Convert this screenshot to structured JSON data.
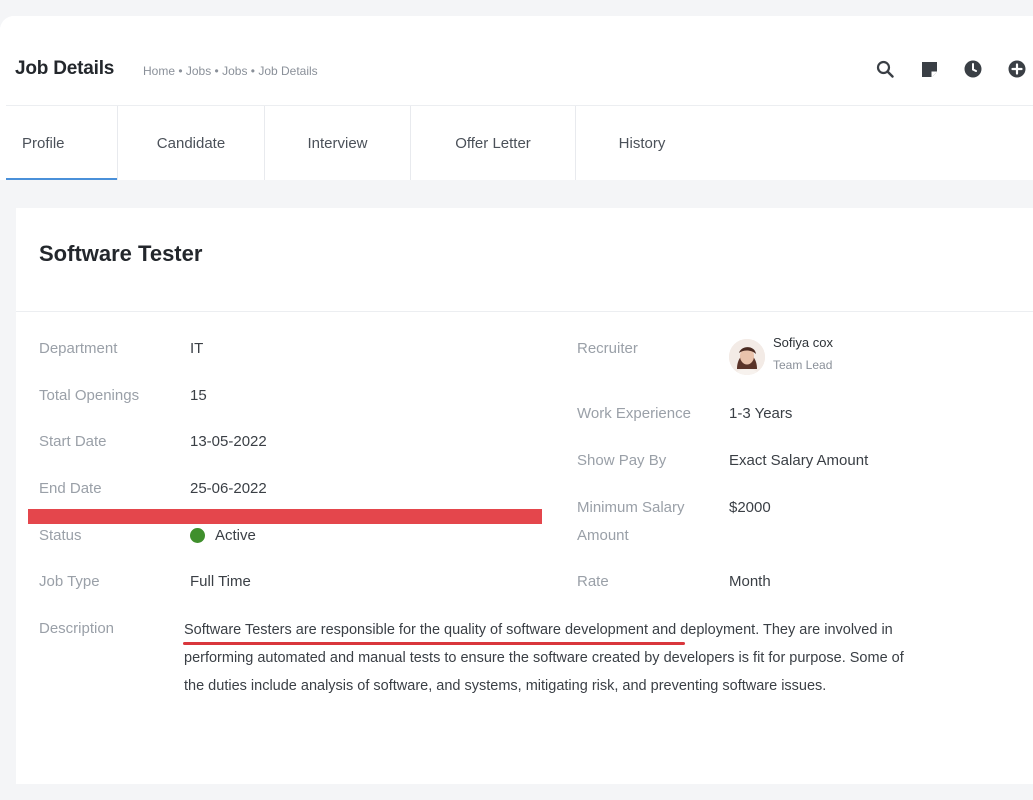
{
  "header": {
    "title": "Job Details",
    "breadcrumb": "Home • Jobs • Jobs • Job Details",
    "icons": [
      "search-icon",
      "note-icon",
      "clock-icon",
      "plus-circle-icon"
    ]
  },
  "tabs": [
    {
      "label": "Profile",
      "active": true
    },
    {
      "label": "Candidate",
      "active": false
    },
    {
      "label": "Interview",
      "active": false
    },
    {
      "label": "Offer Letter",
      "active": false
    },
    {
      "label": "History",
      "active": false
    }
  ],
  "job": {
    "title": "Software Tester",
    "left_fields": [
      {
        "label": "Department",
        "value": "IT"
      },
      {
        "label": "Total Openings",
        "value": "15"
      },
      {
        "label": "Start Date",
        "value": "13-05-2022"
      },
      {
        "label": "End Date",
        "value": "25-06-2022"
      },
      {
        "label": "Status",
        "value": "Active"
      },
      {
        "label": "Job Type",
        "value": "Full Time"
      }
    ],
    "description_label": "Description",
    "description": "Software Testers are responsible for the quality of software development and deployment. They are involved in performing automated and manual tests to ensure the software created by developers is fit for purpose. Some of the duties include analysis of software, and systems, mitigating risk, and preventing software issues.",
    "recruiter": {
      "label": "Recruiter",
      "name": "Sofiya cox",
      "role": "Team Lead"
    },
    "right_fields": [
      {
        "label": "Work Experience",
        "value": "1-3 Years"
      },
      {
        "label": "Show Pay By",
        "value": "Exact Salary Amount"
      },
      {
        "label": "Minimum Salary Amount",
        "value": "$2000"
      },
      {
        "label": "Rate",
        "value": "Month"
      }
    ]
  },
  "colors": {
    "accent": "#4a90d9",
    "status_active": "#3f8f2c",
    "annotation_red": "#e4464c"
  }
}
